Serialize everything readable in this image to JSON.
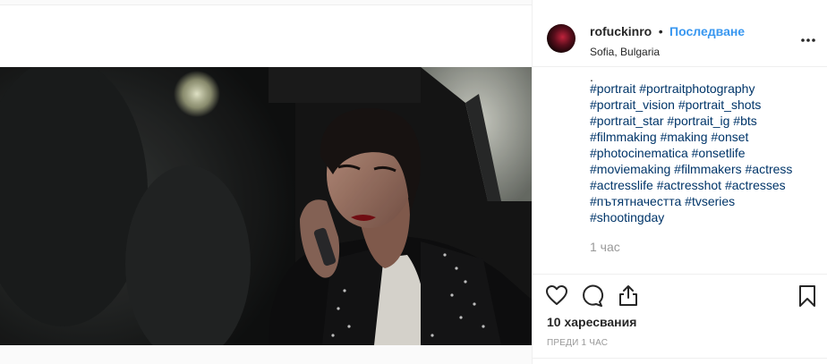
{
  "post": {
    "username": "rofuckinro",
    "separator": "•",
    "follow_label": "Последване",
    "location": "Sofia, Bulgaria",
    "more_icon": "more-horizontal-icon",
    "caption_dot": ".",
    "hashtag_lines": [
      "#portrait #portraitphotography",
      "#portrait_vision #portrait_shots",
      "#portrait_star #portrait_ig #bts",
      "#filmmaking #making #onset",
      "#photocinematica #onsetlife",
      "#moviemaking #filmmakers #actress",
      "#actresslife #actresshot #actresses",
      "#пътятначестта #tvseries",
      "#shootingday"
    ],
    "comment_time": "1 час",
    "likes": "10 харесвания",
    "posted_ago": "ПРЕДИ 1 ЧАС",
    "icons": [
      "heart-icon",
      "comment-icon",
      "share-icon",
      "bookmark-icon"
    ],
    "colors": {
      "link": "#003569",
      "follow": "#3897f0",
      "muted": "#999999"
    }
  }
}
